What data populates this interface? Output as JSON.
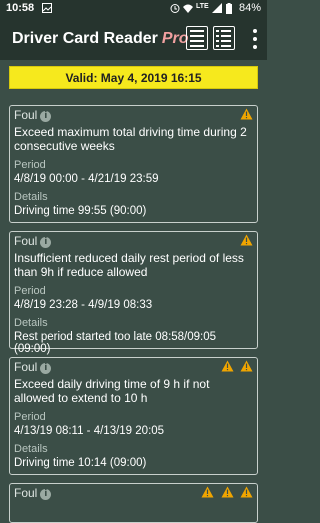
{
  "status_bar": {
    "time": "10:58",
    "network": "LTE",
    "battery": "84%"
  },
  "app": {
    "title": "Driver Card Reader",
    "title_suffix": "Pro"
  },
  "validity": "Valid: May 4, 2019 16:15",
  "colors": {
    "validity_bg": "#f6e91d",
    "warning": "#f0a500",
    "background": "#3b4e47",
    "bar": "#26342e"
  },
  "cards": [
    {
      "type": "Foul",
      "warnings": 1,
      "description": "Exceed maximum total driving time during 2 consecutive weeks",
      "period_label": "Period",
      "period": "4/8/19 00:00 - 4/21/19 23:59",
      "details_label": "Details",
      "details": "Driving time 99:55 (90:00)"
    },
    {
      "type": "Foul",
      "warnings": 1,
      "description": "Insufficient reduced daily rest period of less than 9h if reduce allowed",
      "period_label": "Period",
      "period": "4/8/19 23:28 - 4/9/19 08:33",
      "details_label": "Details",
      "details": "Rest period started too late 08:58/09:05 (09:00)"
    },
    {
      "type": "Foul",
      "warnings": 2,
      "description": "Exceed daily driving time of 9 h if not allowed to extend to 10 h",
      "period_label": "Period",
      "period": "4/13/19 08:11 - 4/13/19 20:05",
      "details_label": "Details",
      "details": "Driving time 10:14 (09:00)"
    },
    {
      "type": "Foul",
      "warnings": 3
    }
  ],
  "icons": {
    "info": "info-icon",
    "warning": "warning-icon",
    "grid_view": "grid-view-icon",
    "list_view": "list-view-icon",
    "overflow": "overflow-menu-icon"
  }
}
